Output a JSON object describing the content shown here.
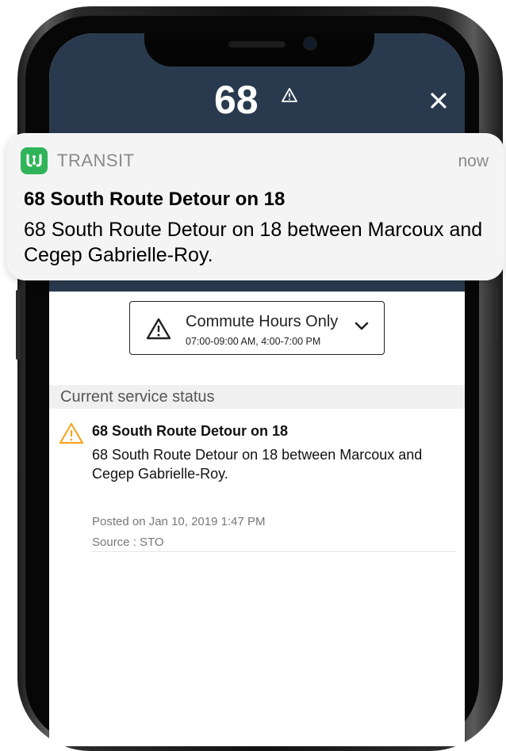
{
  "header": {
    "route_number": "68",
    "background_color": "#2a3a4e",
    "icons": {
      "warning": "warning-triangle-icon",
      "close": "close-icon"
    }
  },
  "notification": {
    "app_name": "TRANSIT",
    "time": "now",
    "title": "68 South Route Detour on 18",
    "body": "68 South Route Detour on 18 between Marcoux and Cegep Gabrielle-Roy.",
    "app_icon_color": "#2fb45a"
  },
  "filter": {
    "title": "Commute Hours Only",
    "subtitle": "07:00-09:00 AM, 4:00-7:00 PM",
    "icons": {
      "warning": "warning-triangle-icon",
      "dropdown": "chevron-down-icon"
    }
  },
  "service_status": {
    "section_label": "Current service status",
    "alert": {
      "title": "68 South Route Detour on 18",
      "description": "68 South Route Detour on 18 between Marcoux and Cegep Gabrielle-Roy.",
      "posted": "Posted on Jan 10, 2019 1:47 PM",
      "source": "Source : STO",
      "icon_color": "#f5a623"
    }
  }
}
